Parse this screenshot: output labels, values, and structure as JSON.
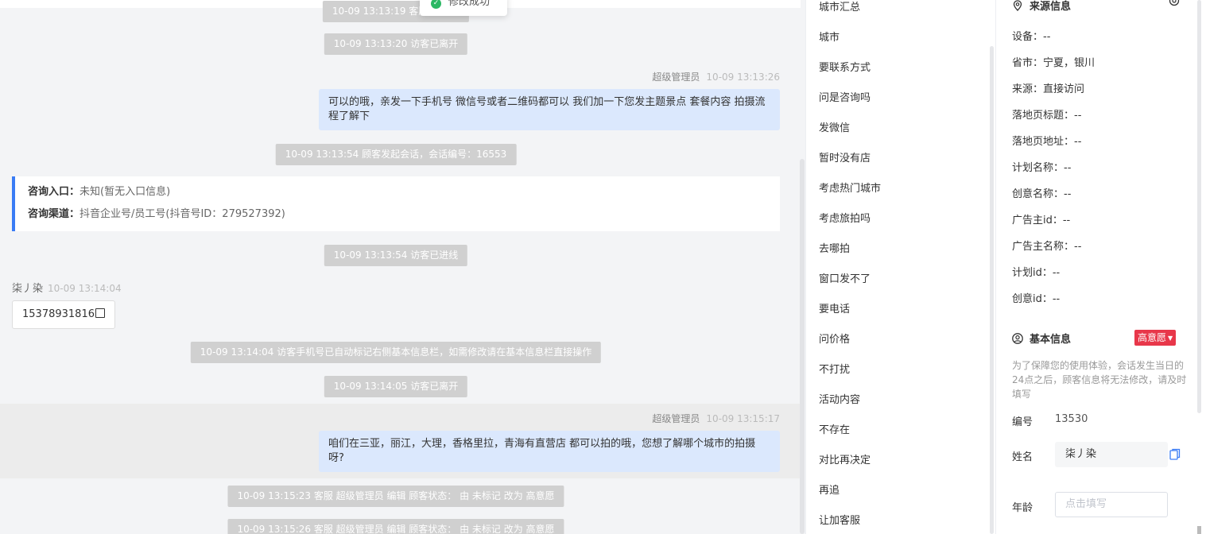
{
  "toast": {
    "text": "修改成功"
  },
  "chat": {
    "system_top_partial": "10-09 13:13:19 客服 超级管",
    "system_left_1": "10-09 13:13:20 访客已离开",
    "agent_msg_1": {
      "sender": "超级管理员",
      "time": "10-09 13:13:26",
      "text": "可以的哦，亲发一下手机号 微信号或者二维码都可以 我们加一下您发主题景点 套餐内容 拍摄流程了解下"
    },
    "system_session_start": "10-09 13:13:54 顾客发起会话，会话编号：16553",
    "consult_card": {
      "entry_label": "咨询入口：",
      "entry_value": "未知(暂无入口信息)",
      "channel_label": "咨询渠道：",
      "channel_value": "抖音企业号/员工号(抖音号ID：279527392)"
    },
    "system_enter": "10-09 13:13:54 访客已进线",
    "visitor": {
      "name": "柒丿染",
      "time": "10-09 13:14:04",
      "phone": "15378931816"
    },
    "system_phone_marked": "10-09 13:14:04 访客手机号已自动标记右侧基本信息栏，如需修改请在基本信息栏直接操作",
    "system_left_2": "10-09 13:14:05 访客已离开",
    "agent_msg_2": {
      "sender": "超级管理员",
      "time": "10-09 13:15:17",
      "text": "咱们在三亚，丽江，大理，香格里拉，青海有直营店 都可以拍的哦，您想了解哪个城市的拍摄呀?"
    },
    "system_edit_1": "10-09 13:15:23 客服 超级管理员 编辑 顾客状态： 由 未标记 改为 高意愿",
    "system_edit_2": "10-09 13:15:26 客服 超级管理员 编辑 顾客状态： 由 未标记 改为 高意愿"
  },
  "quick_replies": [
    "城市汇总",
    "城市",
    "要联系方式",
    "问是咨询吗",
    "发微信",
    "暂时没有店",
    "考虑热门城市",
    "考虑旅拍吗",
    "去哪拍",
    "窗口发不了",
    "要电话",
    "问价格",
    "不打扰",
    "活动内容",
    "不存在",
    "对比再决定",
    "再追",
    "让加客服"
  ],
  "source_info": {
    "title": "来源信息",
    "fields": [
      "设备：--",
      "省市：宁夏，银川",
      "来源：直接访问",
      "落地页标题：--",
      "落地页地址：--",
      "计划名称：--",
      "创意名称：--",
      "广告主id：--",
      "广告主名称：--",
      "计划id：--",
      "创意id：--"
    ]
  },
  "basic_info": {
    "title": "基本信息",
    "intent_tag": "高意愿",
    "hint": "为了保障您的使用体验，会话发生当日的24点之后，顾客信息将无法修改，请及时填写",
    "id_label": "编号",
    "id_value": "13530",
    "name_label": "姓名",
    "name_value": "柒丿染",
    "age_label": "年龄",
    "age_placeholder": "点击填写"
  }
}
